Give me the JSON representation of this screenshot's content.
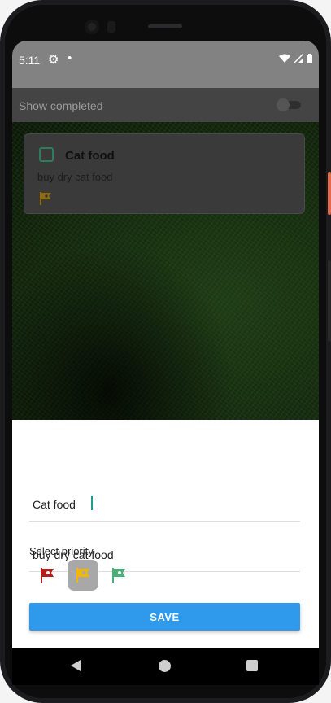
{
  "status_bar": {
    "time": "5:11",
    "icons": [
      "settings-gear-icon",
      "notification-dot-icon",
      "wifi-icon",
      "signal-icon",
      "battery-icon"
    ]
  },
  "toolbar": {
    "show_completed_label": "Show completed",
    "show_completed_on": false
  },
  "task_card": {
    "title": "Cat food",
    "description": "buy dry cat food",
    "checked": false,
    "priority_flag_color": "#c79a12"
  },
  "editor": {
    "title_value": "Cat food",
    "description_value": "buy dry cat food",
    "select_priority_label": "Select priority",
    "priorities": [
      {
        "name": "high",
        "color": "#b71c1c",
        "selected": false
      },
      {
        "name": "medium",
        "color": "#f2b705",
        "selected": true
      },
      {
        "name": "low",
        "color": "#4caf7a",
        "selected": false
      }
    ],
    "save_label": "SAVE"
  },
  "colors": {
    "accent": "#2f99ec",
    "caret": "#1e9e8a"
  }
}
